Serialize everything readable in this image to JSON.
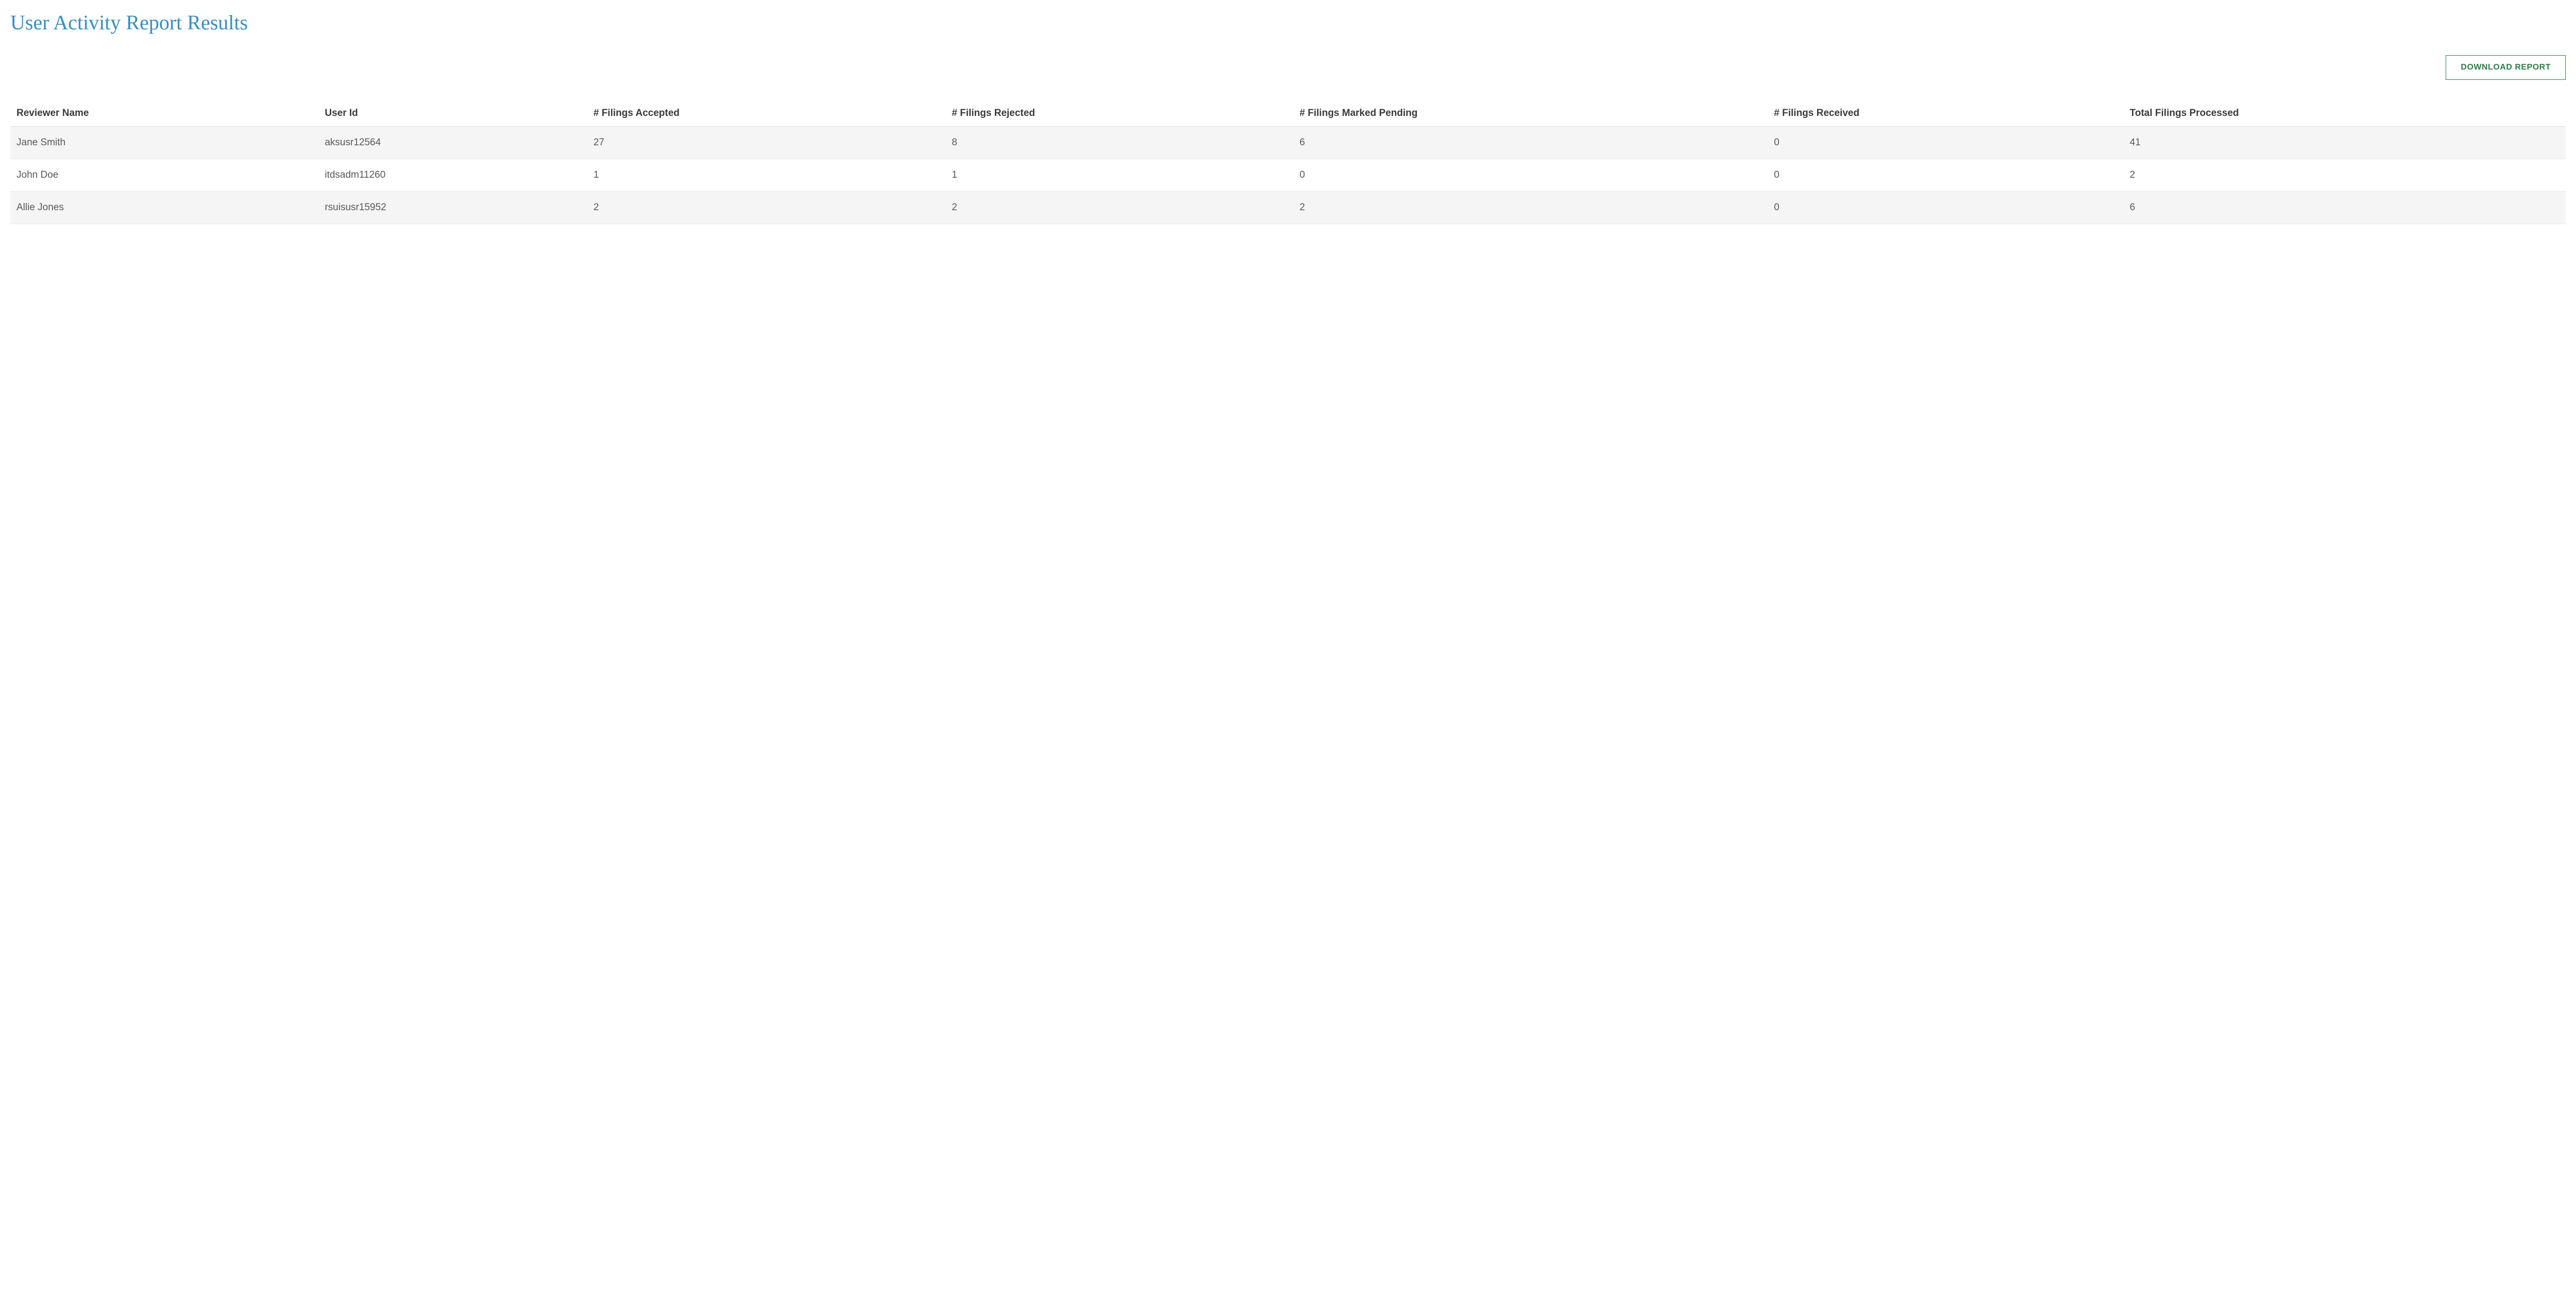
{
  "title": "User Activity Report Results",
  "buttons": {
    "download": "DOWNLOAD REPORT"
  },
  "table": {
    "headers": {
      "reviewer_name": "Reviewer Name",
      "user_id": "User Id",
      "filings_accepted": "# Filings Accepted",
      "filings_rejected": "# Filings Rejected",
      "filings_pending": "# Filings Marked Pending",
      "filings_received": "# Filings Received",
      "total_processed": "Total Filings Processed"
    },
    "rows": [
      {
        "reviewer_name": "Jane Smith",
        "user_id": "aksusr12564",
        "filings_accepted": "27",
        "filings_rejected": "8",
        "filings_pending": "6",
        "filings_received": "0",
        "total_processed": "41"
      },
      {
        "reviewer_name": "John Doe",
        "user_id": "itdsadm11260",
        "filings_accepted": "1",
        "filings_rejected": "1",
        "filings_pending": "0",
        "filings_received": "0",
        "total_processed": "2"
      },
      {
        "reviewer_name": "Allie Jones",
        "user_id": "rsuisusr15952",
        "filings_accepted": "2",
        "filings_rejected": "2",
        "filings_pending": "2",
        "filings_received": "0",
        "total_processed": "6"
      }
    ]
  }
}
